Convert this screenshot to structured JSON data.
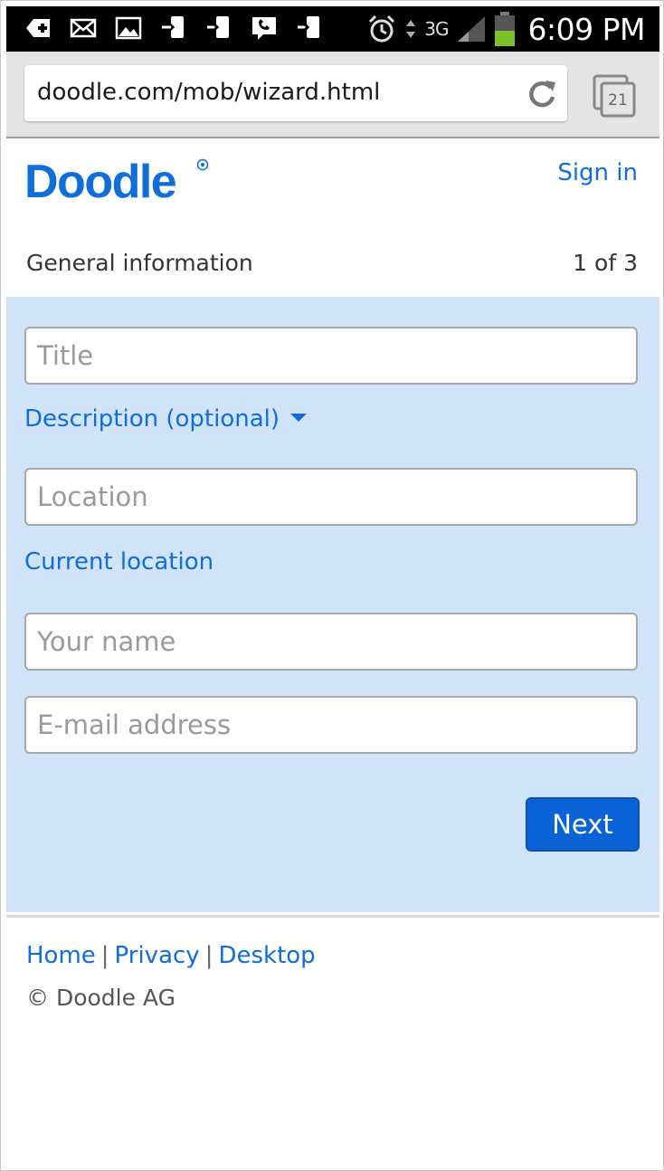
{
  "status_bar": {
    "icons": [
      "plus-notification-icon",
      "mail-icon",
      "image-icon",
      "usb-icon",
      "usb-icon",
      "voicemail-icon",
      "usb-icon",
      "alarm-icon",
      "data-arrows-icon",
      "signal-icon",
      "battery-icon"
    ],
    "network": "3G",
    "time": "6:09 PM"
  },
  "browser": {
    "url": "doodle.com/mob/wizard.html",
    "tab_count": "21"
  },
  "header": {
    "logo": "Doodle",
    "sign_in": "Sign in"
  },
  "wizard": {
    "section_title": "General information",
    "step": "1 of 3",
    "title_placeholder": "Title",
    "description_toggle": "Description (optional)",
    "location_placeholder": "Location",
    "current_location": "Current location",
    "name_placeholder": "Your name",
    "email_placeholder": "E-mail address",
    "next_label": "Next"
  },
  "footer": {
    "links": [
      "Home",
      "Privacy",
      "Desktop"
    ],
    "separator": "|",
    "copyright": "© Doodle AG"
  },
  "colors": {
    "accent": "#0f6ed8",
    "panel_bg": "#d1e3f8",
    "button_bg": "#0a63d6"
  }
}
